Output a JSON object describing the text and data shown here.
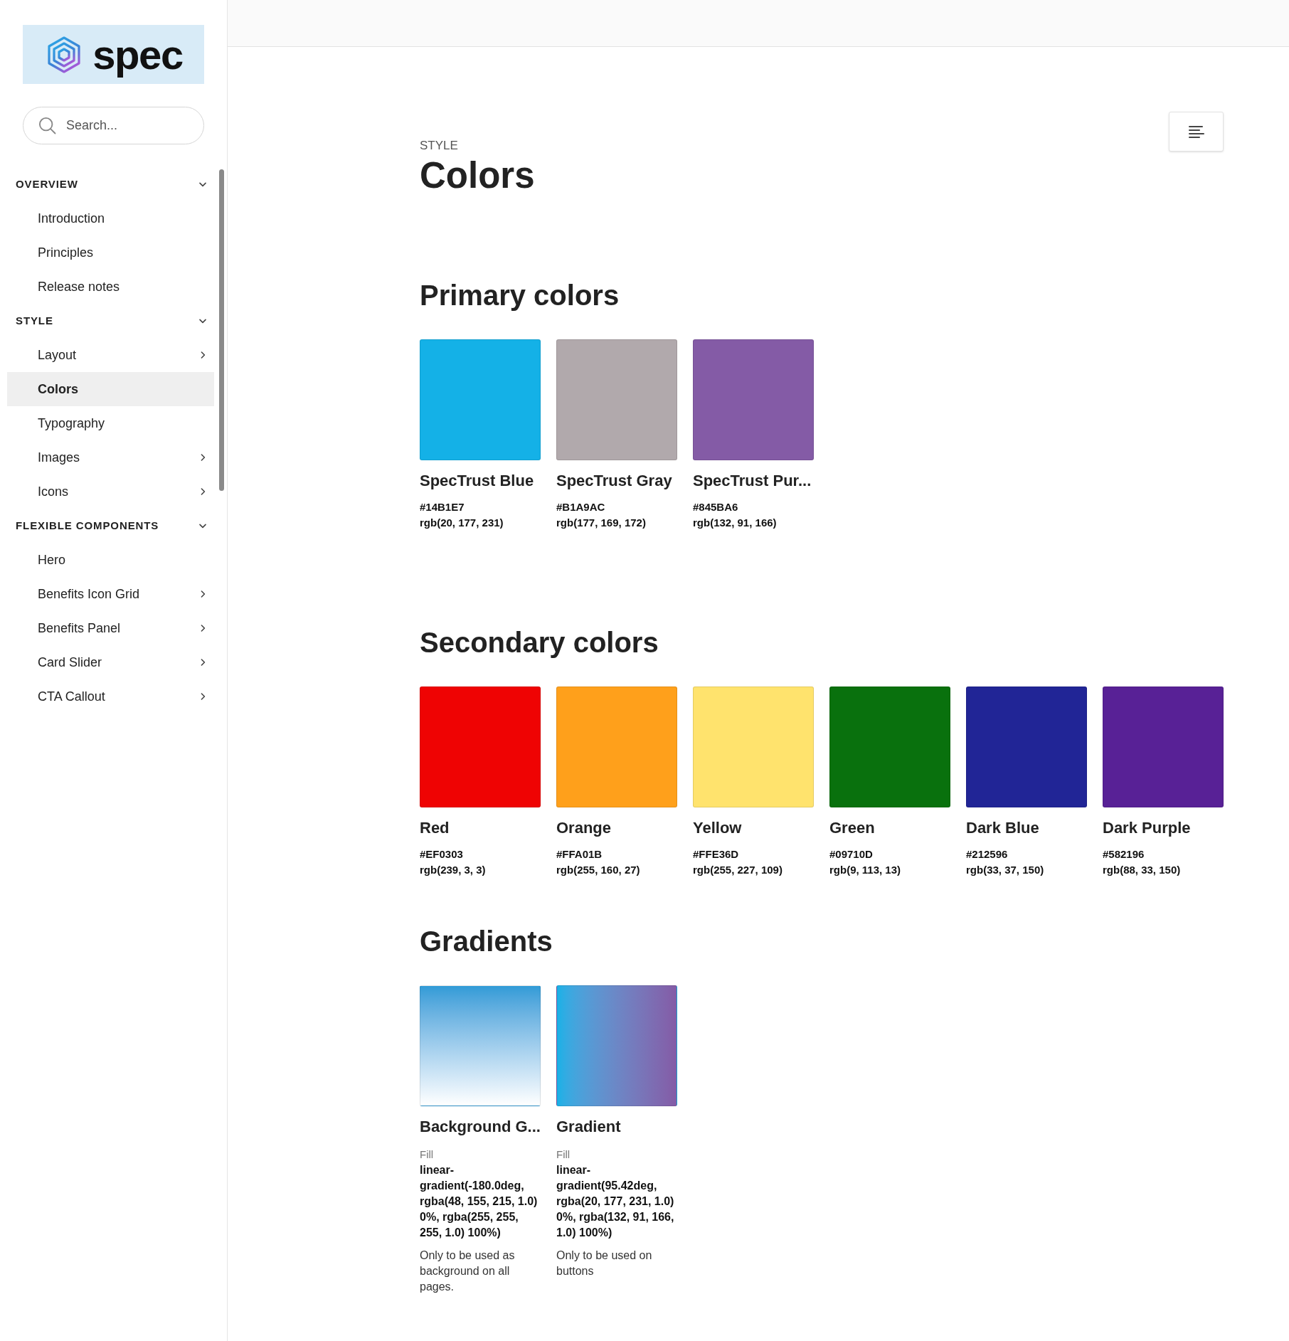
{
  "sidebar": {
    "logo": {
      "text": "spec"
    },
    "search": {
      "placeholder": "Search..."
    },
    "sections": [
      {
        "title": "OVERVIEW",
        "expanded": true,
        "items": [
          {
            "label": "Introduction",
            "expandable": false,
            "selected": false
          },
          {
            "label": "Principles",
            "expandable": false,
            "selected": false
          },
          {
            "label": "Release notes",
            "expandable": false,
            "selected": false
          }
        ]
      },
      {
        "title": "STYLE",
        "expanded": true,
        "items": [
          {
            "label": "Layout",
            "expandable": true,
            "selected": false
          },
          {
            "label": "Colors",
            "expandable": false,
            "selected": true
          },
          {
            "label": "Typography",
            "expandable": false,
            "selected": false
          },
          {
            "label": "Images",
            "expandable": true,
            "selected": false
          },
          {
            "label": "Icons",
            "expandable": true,
            "selected": false
          }
        ]
      },
      {
        "title": "FLEXIBLE COMPONENTS",
        "expanded": true,
        "items": [
          {
            "label": "Hero",
            "expandable": false,
            "selected": false
          },
          {
            "label": "Benefits Icon Grid",
            "expandable": true,
            "selected": false
          },
          {
            "label": "Benefits Panel",
            "expandable": true,
            "selected": false
          },
          {
            "label": "Card Slider",
            "expandable": true,
            "selected": false
          },
          {
            "label": "CTA Callout",
            "expandable": true,
            "selected": false
          }
        ]
      }
    ]
  },
  "page": {
    "eyebrow": "STYLE",
    "title": "Colors",
    "sections": [
      {
        "heading": "Primary colors",
        "swatches": [
          {
            "kind": "solid",
            "name": "SpecTrust Blue",
            "color": "#14b1e7",
            "hex": "#14B1E7",
            "rgb": "rgb(20, 177, 231)"
          },
          {
            "kind": "solid",
            "name": "SpecTrust Gray",
            "color": "#b1a9ac",
            "hex": "#B1A9AC",
            "rgb": "rgb(177, 169, 172)"
          },
          {
            "kind": "solid",
            "name": "SpecTrust Pur...",
            "color": "#845ba6",
            "hex": "#845BA6",
            "rgb": "rgb(132, 91, 166)"
          }
        ]
      },
      {
        "heading": "Secondary colors",
        "swatches": [
          {
            "kind": "solid",
            "name": "Red",
            "color": "#ef0303",
            "hex": "#EF0303",
            "rgb": "rgb(239, 3, 3)"
          },
          {
            "kind": "solid",
            "name": "Orange",
            "color": "#ffa01b",
            "hex": "#FFA01B",
            "rgb": "rgb(255, 160, 27)"
          },
          {
            "kind": "solid",
            "name": "Yellow",
            "color": "#ffe36d",
            "hex": "#FFE36D",
            "rgb": "rgb(255, 227, 109)"
          },
          {
            "kind": "solid",
            "name": "Green",
            "color": "#09710d",
            "hex": "#09710D",
            "rgb": "rgb(9, 113, 13)"
          },
          {
            "kind": "solid",
            "name": "Dark Blue",
            "color": "#212596",
            "hex": "#212596",
            "rgb": "rgb(33, 37, 150)"
          },
          {
            "kind": "solid",
            "name": "Dark Purple",
            "color": "#582196",
            "hex": "#582196",
            "rgb": "rgb(88, 33, 150)"
          }
        ]
      },
      {
        "heading": "Gradients",
        "swatches": [
          {
            "name": "Background G...",
            "kind": "gradient",
            "fill_label": "Fill",
            "fill": "linear-gradient(-180.0deg, rgba(48, 155, 215, 1.0) 0%, rgba(255, 255, 255, 1.0) 100%)",
            "note": "Only to be used as background on all pages."
          },
          {
            "name": "Gradient",
            "kind": "gradient",
            "fill_label": "Fill",
            "fill": "linear-gradient(95.42deg, rgba(20, 177, 231, 1.0) 0%, rgba(132, 91, 166, 1.0) 100%)",
            "note": "Only to be used on buttons"
          }
        ]
      }
    ]
  }
}
